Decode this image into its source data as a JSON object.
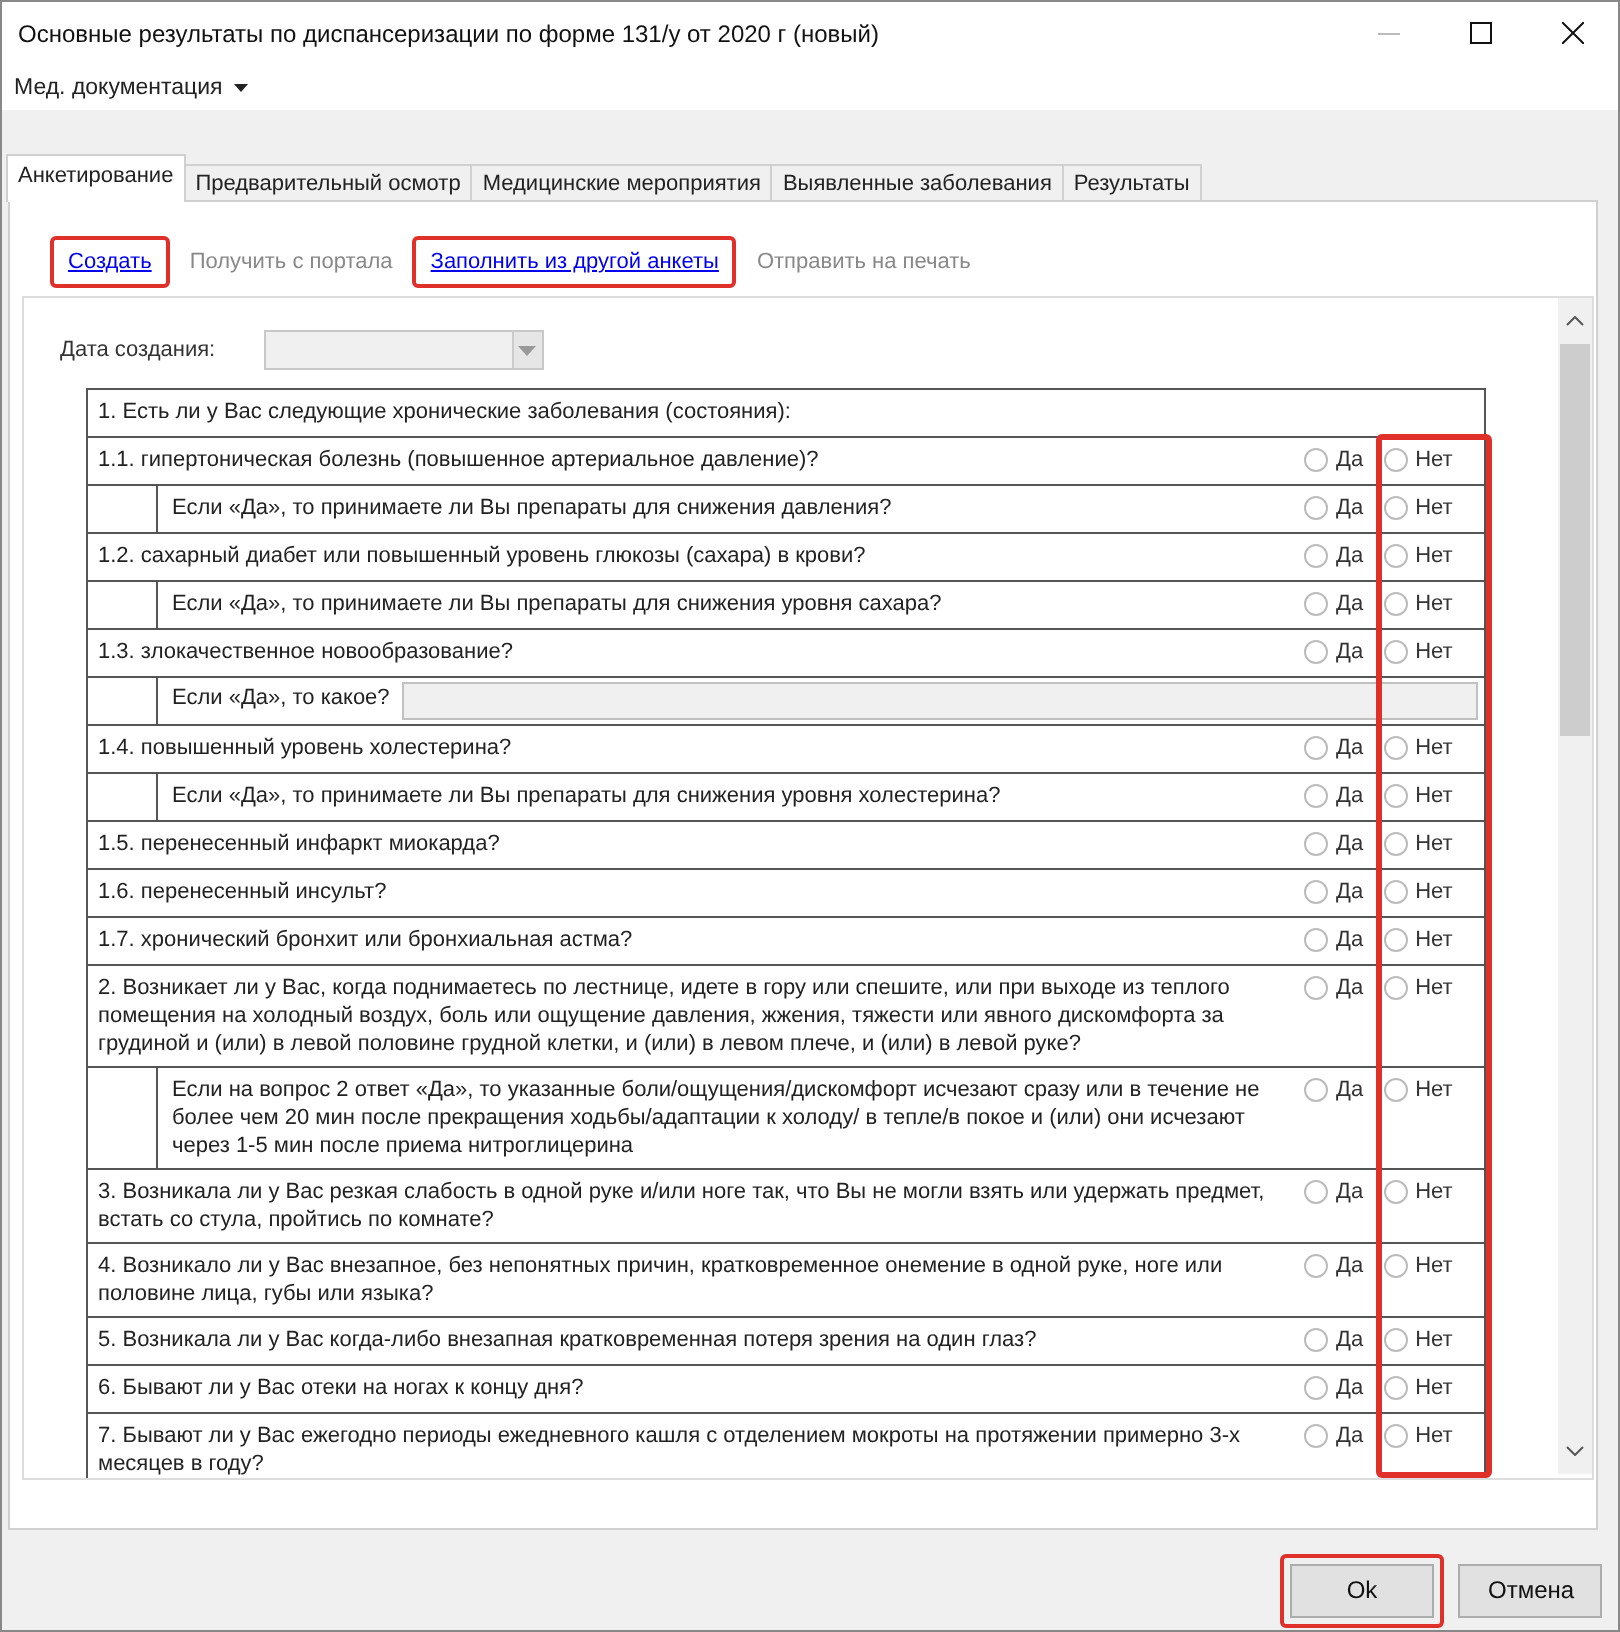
{
  "window": {
    "title": "Основные результаты по диспансеризации по форме 131/у от 2020 г (новый)"
  },
  "menu": [
    {
      "label": "Мед. документация",
      "has_dropdown": true
    }
  ],
  "tabs": [
    {
      "label": "Анкетирование",
      "selected": true
    },
    {
      "label": "Предварительный осмотр",
      "selected": false
    },
    {
      "label": "Медицинские мероприятия",
      "selected": false
    },
    {
      "label": "Выявленные заболевания",
      "selected": false
    },
    {
      "label": "Результаты",
      "selected": false
    }
  ],
  "actions": [
    {
      "label": "Создать",
      "disabled": false,
      "highlighted": true
    },
    {
      "label": "Получить с портала",
      "disabled": true,
      "highlighted": false
    },
    {
      "label": "Заполнить из другой анкеты",
      "disabled": false,
      "highlighted": true
    },
    {
      "label": "Отправить на печать",
      "disabled": true,
      "highlighted": false
    }
  ],
  "date_field": {
    "label": "Дата создания:",
    "disabled": true
  },
  "questionnaire": {
    "no_column_highlighted": true,
    "rows": [
      {
        "kind": "header",
        "text": "1. Есть ли у Вас следующие хронические заболевания (состояния):"
      },
      {
        "kind": "question",
        "text": "1.1. гипертоническая болезнь (повышенное артериальное давление)?",
        "options": [
          {
            "label": "Да",
            "selected": false
          },
          {
            "label": "Нет",
            "selected": false
          }
        ]
      },
      {
        "kind": "sub_question",
        "text": "Если «Да», то принимаете ли Вы препараты для снижения давления?",
        "options": [
          {
            "label": "Да",
            "selected": false
          },
          {
            "label": "Нет",
            "selected": false
          }
        ]
      },
      {
        "kind": "question",
        "text": "1.2. сахарный диабет или повышенный уровень глюкозы (сахара) в крови?",
        "options": [
          {
            "label": "Да",
            "selected": false
          },
          {
            "label": "Нет",
            "selected": false
          }
        ]
      },
      {
        "kind": "sub_question",
        "text": "Если «Да», то принимаете ли Вы препараты для снижения уровня сахара?",
        "options": [
          {
            "label": "Да",
            "selected": false
          },
          {
            "label": "Нет",
            "selected": false
          }
        ]
      },
      {
        "kind": "question",
        "text": "1.3. злокачественное новообразование?",
        "options": [
          {
            "label": "Да",
            "selected": false
          },
          {
            "label": "Нет",
            "selected": false
          }
        ]
      },
      {
        "kind": "sub_input",
        "text": "Если «Да», то какое?",
        "disabled": true
      },
      {
        "kind": "question",
        "text": "1.4. повышенный уровень холестерина?",
        "options": [
          {
            "label": "Да",
            "selected": false
          },
          {
            "label": "Нет",
            "selected": false
          }
        ]
      },
      {
        "kind": "sub_question",
        "text": "Если «Да», то принимаете ли Вы препараты для снижения уровня холестерина?",
        "options": [
          {
            "label": "Да",
            "selected": false
          },
          {
            "label": "Нет",
            "selected": false
          }
        ]
      },
      {
        "kind": "question",
        "text": "1.5. перенесенный инфаркт миокарда?",
        "options": [
          {
            "label": "Да",
            "selected": false
          },
          {
            "label": "Нет",
            "selected": false
          }
        ]
      },
      {
        "kind": "question",
        "text": "1.6. перенесенный инсульт?",
        "options": [
          {
            "label": "Да",
            "selected": false
          },
          {
            "label": "Нет",
            "selected": false
          }
        ]
      },
      {
        "kind": "question",
        "text": "1.7. хронический бронхит или бронхиальная астма?",
        "options": [
          {
            "label": "Да",
            "selected": false
          },
          {
            "label": "Нет",
            "selected": false
          }
        ]
      },
      {
        "kind": "question",
        "text": "2. Возникает ли у Вас, когда поднимаетесь по лестнице, идете в гору или спешите, или при выходе из теплого помещения на холодный воздух, боль или ощущение давления, жжения, тяжести или явного дискомфорта за грудиной и (или) в левой половине грудной клетки, и (или) в левом плече, и (или) в левой руке?",
        "options": [
          {
            "label": "Да",
            "selected": false
          },
          {
            "label": "Нет",
            "selected": false
          }
        ]
      },
      {
        "kind": "sub_question",
        "text": "Если на вопрос 2 ответ «Да», то указанные боли/ощущения/дискомфорт исчезают сразу или в течение не более чем 20 мин после прекращения ходьбы/адаптации к холоду/ в тепле/в покое и (или) они исчезают через 1-5 мин после приема нитроглицерина",
        "options": [
          {
            "label": "Да",
            "selected": false
          },
          {
            "label": "Нет",
            "selected": false
          }
        ]
      },
      {
        "kind": "question",
        "text": "3. Возникала ли у Вас резкая слабость в одной руке и/или ноге так, что Вы не могли взять или удержать предмет, встать со стула, пройтись по комнате?",
        "options": [
          {
            "label": "Да",
            "selected": false
          },
          {
            "label": "Нет",
            "selected": false
          }
        ]
      },
      {
        "kind": "question",
        "text": "4. Возникало ли у Вас внезапное, без непонятных причин, кратковременное онемение в одной руке, ноге или половине лица, губы или языка?",
        "options": [
          {
            "label": "Да",
            "selected": false
          },
          {
            "label": "Нет",
            "selected": false
          }
        ]
      },
      {
        "kind": "question",
        "text": "5. Возникала ли у Вас когда-либо внезапная кратковременная потеря зрения на один глаз?",
        "options": [
          {
            "label": "Да",
            "selected": false
          },
          {
            "label": "Нет",
            "selected": false
          }
        ]
      },
      {
        "kind": "question",
        "text": "6. Бывают ли у Вас отеки на ногах к концу дня?",
        "options": [
          {
            "label": "Да",
            "selected": false
          },
          {
            "label": "Нет",
            "selected": false
          }
        ]
      },
      {
        "kind": "question",
        "text": "7. Бывают ли у Вас ежегодно периоды ежедневного кашля с отделением мокроты на протяжении примерно 3-х месяцев в году?",
        "options": [
          {
            "label": "Да",
            "selected": false
          },
          {
            "label": "Нет",
            "selected": false
          }
        ]
      }
    ]
  },
  "buttons": [
    {
      "label": "Ok",
      "highlighted": true
    },
    {
      "label": "Отмена",
      "highlighted": false
    }
  ]
}
